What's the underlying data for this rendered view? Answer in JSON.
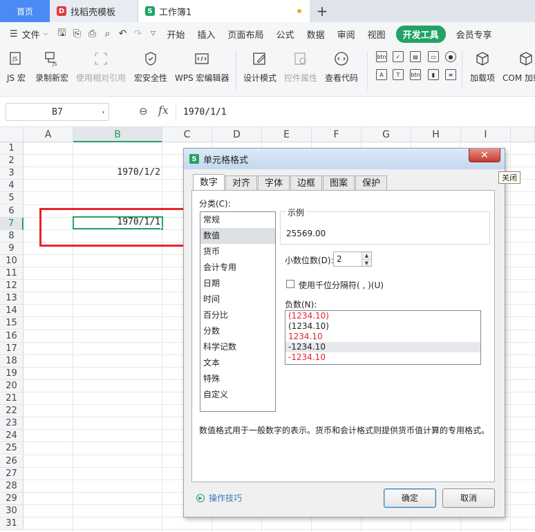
{
  "tabs": {
    "home": "首页",
    "shell_template": "找稻壳模板",
    "workbook": "工作簿1",
    "add_tab": "+"
  },
  "menu": {
    "file": "文件",
    "items": [
      "开始",
      "插入",
      "页面布局",
      "公式",
      "数据",
      "审阅",
      "视图"
    ],
    "developer": "开发工具",
    "member": "会员专享"
  },
  "ribbon": {
    "js_macro": "JS 宏",
    "record_macro": "录制新宏",
    "relative_ref": "使用相对引用",
    "macro_security": "宏安全性",
    "wps_macro_editor": "WPS 宏编辑器",
    "design_mode": "设计模式",
    "control_props": "控件属性",
    "view_code": "查看代码",
    "addins": "加载项",
    "com_addins": "COM 加载项"
  },
  "formula_bar": {
    "name_box": "B7",
    "fx": "fx",
    "value": "1970/1/1"
  },
  "grid": {
    "columns": [
      "A",
      "B",
      "C",
      "D",
      "E",
      "F",
      "G",
      "H",
      "I"
    ],
    "rows": [
      "1",
      "2",
      "3",
      "4",
      "5",
      "6",
      "7",
      "8",
      "9",
      "10",
      "11",
      "12",
      "13",
      "14",
      "15",
      "16",
      "17",
      "18",
      "19",
      "20",
      "21",
      "22",
      "23",
      "24",
      "25",
      "26",
      "27",
      "28",
      "29",
      "30",
      "31"
    ],
    "cell_b3": "1970/1/2",
    "cell_b7": "1970/1/1",
    "selected_col": "B",
    "selected_row": "7"
  },
  "dialog": {
    "title": "单元格格式",
    "close_tooltip": "关闭",
    "tabs": [
      "数字",
      "对齐",
      "字体",
      "边框",
      "图案",
      "保护"
    ],
    "category_label": "分类(C):",
    "categories": [
      "常规",
      "数值",
      "货币",
      "会计专用",
      "日期",
      "时间",
      "百分比",
      "分数",
      "科学记数",
      "文本",
      "特殊",
      "自定义"
    ],
    "selected_category": "数值",
    "sample_label": "示例",
    "sample_value": "25569.00",
    "decimal_label": "小数位数(D):",
    "decimal_value": "2",
    "thousands_label": "使用千位分隔符( , )(U)",
    "negative_label": "负数(N):",
    "negatives": [
      {
        "text": "(1234.10)",
        "color": "#e8232b"
      },
      {
        "text": "(1234.10)",
        "color": "#222222"
      },
      {
        "text": "1234.10",
        "color": "#e8232b"
      },
      {
        "text": "-1234.10",
        "color": "#222222"
      },
      {
        "text": "-1234.10",
        "color": "#e8232b"
      }
    ],
    "description": "数值格式用于一般数字的表示。货币和会计格式则提供货币值计算的专用格式。",
    "tips": "操作技巧",
    "ok": "确定",
    "cancel": "取消"
  },
  "colors": {
    "accent_green": "#21a366",
    "annotation_red": "#e8232b",
    "home_tab_blue": "#4a8af4"
  }
}
